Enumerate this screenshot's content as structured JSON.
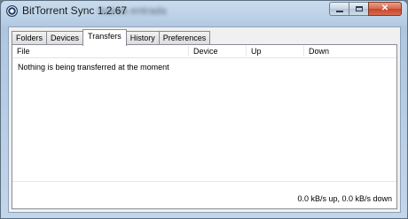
{
  "window": {
    "title": "BitTorrent Sync 1.2.67",
    "title_extra": "nueva entrada",
    "controls": {
      "minimize_icon": "minimize-icon",
      "maximize_icon": "maximize-icon",
      "close_label": "✕"
    }
  },
  "tabs": [
    {
      "label": "Folders",
      "active": false
    },
    {
      "label": "Devices",
      "active": false
    },
    {
      "label": "Transfers",
      "active": true
    },
    {
      "label": "History",
      "active": false
    },
    {
      "label": "Preferences",
      "active": false
    }
  ],
  "transfers": {
    "columns": [
      "File",
      "Device",
      "Up",
      "Down"
    ],
    "empty_message": "Nothing is being transferred at the moment"
  },
  "status": {
    "speed": "0.0 kB/s up, 0.0 kB/s down"
  },
  "colors": {
    "accent": "#c7452a",
    "frame": "#b9cfe5"
  }
}
